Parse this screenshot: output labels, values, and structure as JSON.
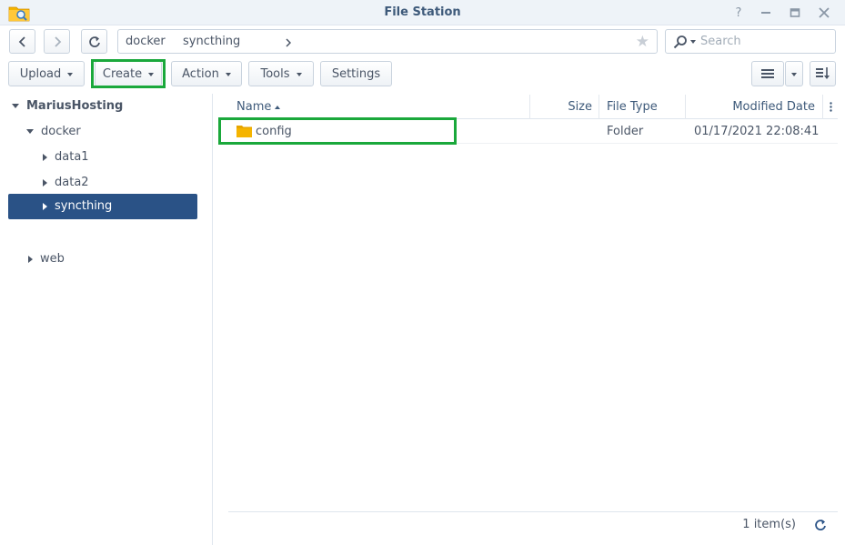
{
  "window": {
    "title": "File Station",
    "app_icon": "folder-search-icon",
    "help_icon": "?",
    "minimize_icon": "minimize-icon",
    "maximize_icon": "maximize-icon",
    "close_icon": "close-icon"
  },
  "nav": {
    "path": [
      "docker",
      "syncthing"
    ],
    "search_placeholder": "Search"
  },
  "toolbar": {
    "upload": "Upload",
    "create": "Create",
    "action": "Action",
    "tools": "Tools",
    "settings": "Settings"
  },
  "tree": {
    "root": "MariusHosting",
    "docker": "docker",
    "data1": "data1",
    "data2": "data2",
    "syncthing": "syncthing",
    "web": "web"
  },
  "list": {
    "columns": {
      "name": "Name",
      "size": "Size",
      "type": "File Type",
      "modified": "Modified Date"
    },
    "rows": [
      {
        "name": "config",
        "size": "",
        "type": "Folder",
        "modified": "01/17/2021 22:08:41"
      }
    ],
    "count": "1 item(s)"
  },
  "colors": {
    "accent": "#2a5286",
    "highlight": "#1aa83b",
    "folder": "#f5b400"
  }
}
